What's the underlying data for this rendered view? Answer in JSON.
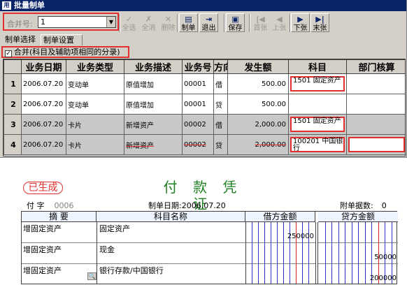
{
  "window": {
    "title": "批量制单"
  },
  "toolbar": {
    "merge_label": "合并号:",
    "merge_value": "1",
    "buttons": [
      {
        "label": "全选",
        "icon": "select-all-icon",
        "glyph": "✓",
        "enabled": false
      },
      {
        "label": "全消",
        "icon": "deselect-all-icon",
        "glyph": "✗",
        "enabled": false
      },
      {
        "label": "删除",
        "icon": "delete-icon",
        "glyph": "✕",
        "enabled": false
      },
      {
        "label": "制单",
        "icon": "make-voucher-icon",
        "glyph": "▤",
        "enabled": true
      },
      {
        "label": "退出",
        "icon": "exit-icon",
        "glyph": "⇥",
        "enabled": true
      },
      {
        "label": "保存",
        "icon": "save-icon",
        "glyph": "▣",
        "enabled": true
      },
      {
        "label": "首张",
        "icon": "first-icon",
        "glyph": "|◀",
        "enabled": false
      },
      {
        "label": "上张",
        "icon": "prev-icon",
        "glyph": "◀",
        "enabled": false
      },
      {
        "label": "下张",
        "icon": "next-icon",
        "glyph": "▶",
        "enabled": true
      },
      {
        "label": "末张",
        "icon": "last-icon",
        "glyph": "▶|",
        "enabled": true
      }
    ]
  },
  "tabs": [
    "制单选择",
    "制单设置"
  ],
  "merge_checkbox": {
    "label": "合并(科目及辅助项相同的分录)",
    "checked": true,
    "mark": "✓"
  },
  "grid": {
    "headers": [
      "",
      "业务日期",
      "业务类型",
      "业务描述",
      "业务号",
      "方向",
      "发生额",
      "科目",
      "部门核算"
    ],
    "rows": [
      {
        "no": "1",
        "date": "2006.07.20",
        "type": "变动单",
        "desc": "原值增加",
        "bizno": "00001",
        "dir": "借",
        "amount": "500.00",
        "subject": "1501  固定资产",
        "dept": ""
      },
      {
        "no": "2",
        "date": "2006.07.20",
        "type": "变动单",
        "desc": "原值增加",
        "bizno": "00001",
        "dir": "贷",
        "amount": "500.00",
        "subject": "",
        "dept": ""
      },
      {
        "no": "3",
        "date": "2006.07.20",
        "type": "卡片",
        "desc": "新增资产",
        "bizno": "00002",
        "dir": "借",
        "amount": "2,000.00",
        "subject": "1501  固定资产",
        "dept": ""
      },
      {
        "no": "4",
        "date": "2006.07.20",
        "type": "卡片",
        "desc": "新增资产",
        "bizno": "00002",
        "dir": "贷",
        "amount": "2,000.00",
        "subject": "100201  中国银行",
        "dept": ""
      }
    ]
  },
  "voucher": {
    "stamp": "已生成",
    "title": "付 款 凭 证",
    "word_label": "付 字",
    "word_no": "0006",
    "date_label": "制单日期:",
    "date": "2006.07.20",
    "attach_label": "附单据数:",
    "attach_count": "0",
    "headers": {
      "summary": "摘 要",
      "account": "科目名称",
      "debit": "借方金额",
      "credit": "贷方金额"
    },
    "lines": [
      {
        "summary": "增固定资产",
        "account": "固定资产",
        "debit": "250000",
        "credit": ""
      },
      {
        "summary": "增固定资产",
        "account": "现金",
        "debit": "",
        "credit": "50000"
      },
      {
        "summary": "增固定资产",
        "account": "银行存款/中国银行",
        "debit": "",
        "credit": "200000"
      }
    ],
    "colors": {
      "title": "#208020",
      "stamp": "#e03030",
      "digit_line_blue": "#3030c0",
      "digit_line_red": "#d02020"
    }
  }
}
